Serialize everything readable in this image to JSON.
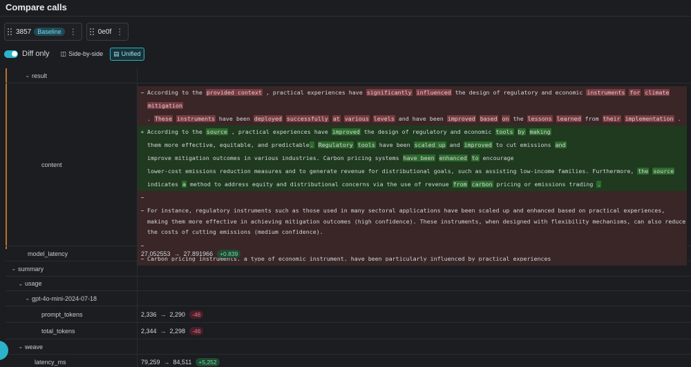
{
  "page": {
    "title": "Compare calls"
  },
  "calls": [
    {
      "id": "3857",
      "badge": "Baseline"
    },
    {
      "id": "0e0f"
    }
  ],
  "toolbar": {
    "diff_only_label": "Diff only",
    "diff_only_on": true,
    "side_by_side_label": "Side-by-side",
    "unified_label": "Unified",
    "active_mode": "Unified"
  },
  "rows": {
    "result": "result",
    "content": "content",
    "model_latency": {
      "key": "model_latency",
      "from": "27.052553",
      "to": "27.891966",
      "delta": "+0.839"
    },
    "summary": "summary",
    "usage": "usage",
    "model": "gpt-4o-mini-2024-07-18",
    "prompt_tokens": {
      "key": "prompt_tokens",
      "from": "2,336",
      "to": "2,290",
      "delta": "-46"
    },
    "total_tokens": {
      "key": "total_tokens",
      "from": "2,344",
      "to": "2,298",
      "delta": "-46"
    },
    "weave": "weave",
    "latency_ms": {
      "key": "latency_ms",
      "from": "79,259",
      "to": "84,511",
      "delta": "+5,252"
    }
  },
  "diff": {
    "minus": "−",
    "plus": "+",
    "arrow": "→",
    "del1": [
      {
        "t": "According to the "
      },
      {
        "t": "provided context",
        "h": true
      },
      {
        "t": " , practical experiences have "
      },
      {
        "t": "significantly",
        "h": true
      },
      {
        "t": " "
      },
      {
        "t": "influenced",
        "h": true
      },
      {
        "t": " the design of regulatory and economic "
      },
      {
        "t": "instruments",
        "h": true
      },
      {
        "t": " "
      },
      {
        "t": "for",
        "h": true
      },
      {
        "t": " "
      },
      {
        "t": "climate",
        "h": true
      },
      {
        "t": " "
      },
      {
        "t": "mitigation",
        "h": true
      }
    ],
    "del1b": [
      {
        "t": ". "
      },
      {
        "t": "These",
        "h": true
      },
      {
        "t": " "
      },
      {
        "t": "instruments",
        "h": true
      },
      {
        "t": " have been "
      },
      {
        "t": "deployed",
        "h": true
      },
      {
        "t": " "
      },
      {
        "t": "successfully",
        "h": true
      },
      {
        "t": " "
      },
      {
        "t": "at",
        "h": true
      },
      {
        "t": " "
      },
      {
        "t": "various",
        "h": true
      },
      {
        "t": " "
      },
      {
        "t": "levels",
        "h": true
      },
      {
        "t": " and "
      },
      {
        "t": "have been",
        "h": false
      },
      {
        "t": " "
      },
      {
        "t": "improved",
        "h": true
      },
      {
        "t": " "
      },
      {
        "t": "based",
        "h": true
      },
      {
        "t": " "
      },
      {
        "t": "on",
        "h": true
      },
      {
        "t": " the "
      },
      {
        "t": "lessons",
        "h": true
      },
      {
        "t": " "
      },
      {
        "t": "learned",
        "h": true
      },
      {
        "t": " from "
      },
      {
        "t": "their",
        "h": true
      },
      {
        "t": " "
      },
      {
        "t": "implementation",
        "h": true
      },
      {
        "t": " ."
      }
    ],
    "ins1": [
      {
        "t": "According to the "
      },
      {
        "t": "source",
        "h": true
      },
      {
        "t": " , practical experiences have "
      },
      {
        "t": "improved",
        "h": true
      },
      {
        "t": " the design of regulatory and economic "
      },
      {
        "t": "tools",
        "h": true
      },
      {
        "t": " "
      },
      {
        "t": "by",
        "h": true
      },
      {
        "t": " "
      },
      {
        "t": "making",
        "h": true
      }
    ],
    "ins2": [
      {
        "t": "them more effective, equitable, and predictable"
      },
      {
        "t": ".",
        "h": true
      },
      {
        "t": " "
      },
      {
        "t": "Regulatory",
        "h": true
      },
      {
        "t": " "
      },
      {
        "t": "tools",
        "h": true
      },
      {
        "t": " have been "
      },
      {
        "t": "scaled up",
        "h": true
      },
      {
        "t": " and "
      },
      {
        "t": "improved",
        "h": true
      },
      {
        "t": " to cut emissions "
      },
      {
        "t": "and",
        "h": true
      }
    ],
    "ins3": [
      {
        "t": "improve mitigation outcomes in various industries. Carbon pricing systems "
      },
      {
        "t": "have been",
        "h": true
      },
      {
        "t": " "
      },
      {
        "t": "enhanced",
        "h": true
      },
      {
        "t": " "
      },
      {
        "t": "to",
        "h": true
      },
      {
        "t": " encourage"
      }
    ],
    "ins4": [
      {
        "t": "lower-cost emissions reduction measures and to generate revenue for distributional goals, such as assisting low-income families. Furthermore, "
      },
      {
        "t": "the",
        "h": true
      },
      {
        "t": " "
      },
      {
        "t": "source",
        "h": true
      }
    ],
    "ins5": [
      {
        "t": "indicates "
      },
      {
        "t": "a",
        "h": true
      },
      {
        "t": " method to address equity and distributional concerns via the use of revenue "
      },
      {
        "t": "from",
        "h": true
      },
      {
        "t": " "
      },
      {
        "t": "carbon",
        "h": true
      },
      {
        "t": " pricing or emissions trading "
      },
      {
        "t": ".",
        "h": true
      }
    ],
    "del2": "For instance, regulatory instruments such as those used in many sectoral applications have been scaled up and enhanced based on practical experiences, making them more effective in achieving mitigation outcomes (high confidence). These instruments, when designed with flexibility mechanisms, can also reduce the costs of cutting emissions (medium confidence).",
    "del3": "Carbon pricing instruments, a type of economic instrument, have been particularly influenced by practical experiences"
  }
}
